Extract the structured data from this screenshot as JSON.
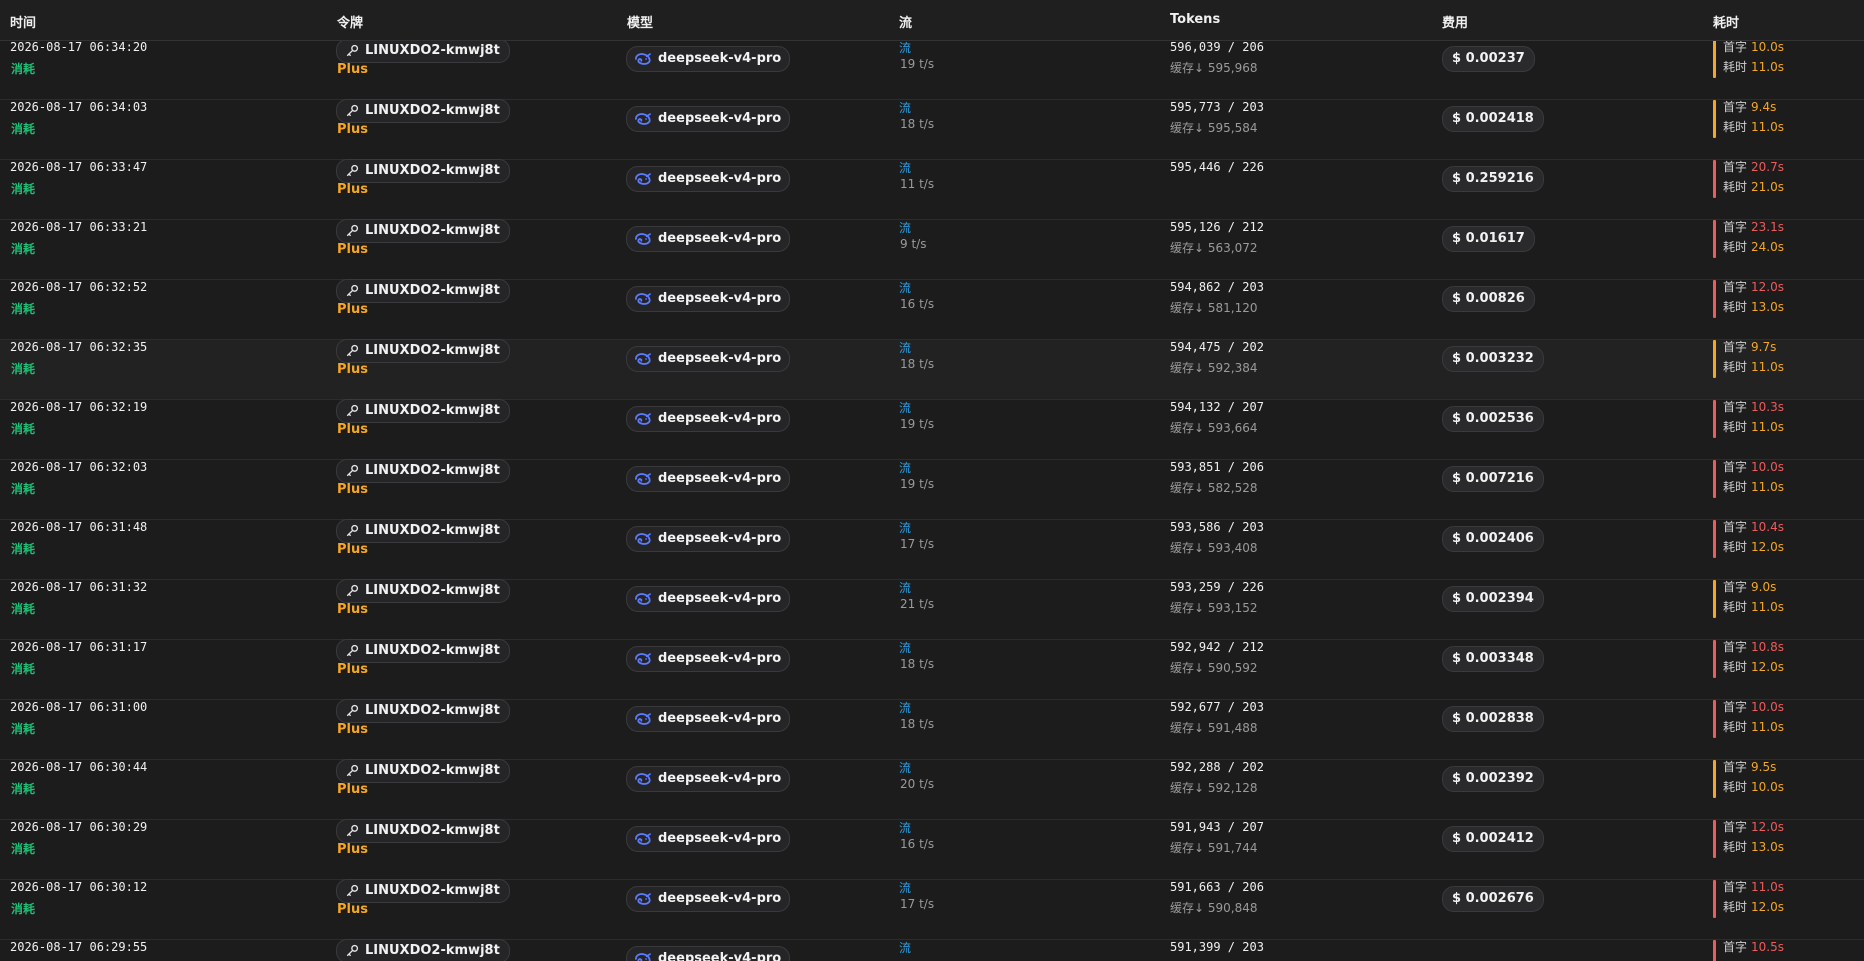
{
  "header": {
    "time": "时间",
    "token": "令牌",
    "model": "模型",
    "flow": "流",
    "tokens": "Tokens",
    "cost": "费用",
    "elapsed": "耗时"
  },
  "labels": {
    "type": "消耗",
    "group": "Plus",
    "flow": "流",
    "cache_prefix": "缓存↓",
    "first_token": "首字",
    "total_time": "耗时"
  },
  "colors": {
    "accent_orange": "#f5a623",
    "accent_red": "#ef5a5a",
    "type_green": "#1fbf74",
    "flow_blue": "#2a9fe0"
  },
  "rows": [
    {
      "time": "2026-08-17 06:34:20",
      "token": "LINUXDO2-kmwj8t",
      "model": "deepseek-v4-pro",
      "speed": "19 t/s",
      "tokens": "596,039 / 206",
      "cache": "595,968",
      "cost": "$ 0.00237",
      "first": "10.0s",
      "total": "11.0s",
      "first_color": "orange",
      "bar_color": "orange"
    },
    {
      "time": "2026-08-17 06:34:03",
      "token": "LINUXDO2-kmwj8t",
      "model": "deepseek-v4-pro",
      "speed": "18 t/s",
      "tokens": "595,773 / 203",
      "cache": "595,584",
      "cost": "$ 0.002418",
      "first": "9.4s",
      "total": "11.0s",
      "first_color": "orange",
      "bar_color": "orange"
    },
    {
      "time": "2026-08-17 06:33:47",
      "token": "LINUXDO2-kmwj8t",
      "model": "deepseek-v4-pro",
      "speed": "11 t/s",
      "tokens": "595,446 / 226",
      "cache": "",
      "cost": "$ 0.259216",
      "first": "20.7s",
      "total": "21.0s",
      "first_color": "red",
      "bar_color": "red"
    },
    {
      "time": "2026-08-17 06:33:21",
      "token": "LINUXDO2-kmwj8t",
      "model": "deepseek-v4-pro",
      "speed": "9 t/s",
      "tokens": "595,126 / 212",
      "cache": "563,072",
      "cost": "$ 0.01617",
      "first": "23.1s",
      "total": "24.0s",
      "first_color": "red",
      "bar_color": "red"
    },
    {
      "time": "2026-08-17 06:32:52",
      "token": "LINUXDO2-kmwj8t",
      "model": "deepseek-v4-pro",
      "speed": "16 t/s",
      "tokens": "594,862 / 203",
      "cache": "581,120",
      "cost": "$ 0.00826",
      "first": "12.0s",
      "total": "13.0s",
      "first_color": "red",
      "bar_color": "red"
    },
    {
      "time": "2026-08-17 06:32:35",
      "token": "LINUXDO2-kmwj8t",
      "model": "deepseek-v4-pro",
      "speed": "18 t/s",
      "tokens": "594,475 / 202",
      "cache": "592,384",
      "cost": "$ 0.003232",
      "first": "9.7s",
      "total": "11.0s",
      "first_color": "orange",
      "bar_color": "orange"
    },
    {
      "time": "2026-08-17 06:32:19",
      "token": "LINUXDO2-kmwj8t",
      "model": "deepseek-v4-pro",
      "speed": "19 t/s",
      "tokens": "594,132 / 207",
      "cache": "593,664",
      "cost": "$ 0.002536",
      "first": "10.3s",
      "total": "11.0s",
      "first_color": "red",
      "bar_color": "red"
    },
    {
      "time": "2026-08-17 06:32:03",
      "token": "LINUXDO2-kmwj8t",
      "model": "deepseek-v4-pro",
      "speed": "19 t/s",
      "tokens": "593,851 / 206",
      "cache": "582,528",
      "cost": "$ 0.007216",
      "first": "10.0s",
      "total": "11.0s",
      "first_color": "red",
      "bar_color": "red"
    },
    {
      "time": "2026-08-17 06:31:48",
      "token": "LINUXDO2-kmwj8t",
      "model": "deepseek-v4-pro",
      "speed": "17 t/s",
      "tokens": "593,586 / 203",
      "cache": "593,408",
      "cost": "$ 0.002406",
      "first": "10.4s",
      "total": "12.0s",
      "first_color": "red",
      "bar_color": "red"
    },
    {
      "time": "2026-08-17 06:31:32",
      "token": "LINUXDO2-kmwj8t",
      "model": "deepseek-v4-pro",
      "speed": "21 t/s",
      "tokens": "593,259 / 226",
      "cache": "593,152",
      "cost": "$ 0.002394",
      "first": "9.0s",
      "total": "11.0s",
      "first_color": "orange",
      "bar_color": "orange"
    },
    {
      "time": "2026-08-17 06:31:17",
      "token": "LINUXDO2-kmwj8t",
      "model": "deepseek-v4-pro",
      "speed": "18 t/s",
      "tokens": "592,942 / 212",
      "cache": "590,592",
      "cost": "$ 0.003348",
      "first": "10.8s",
      "total": "12.0s",
      "first_color": "red",
      "bar_color": "red"
    },
    {
      "time": "2026-08-17 06:31:00",
      "token": "LINUXDO2-kmwj8t",
      "model": "deepseek-v4-pro",
      "speed": "18 t/s",
      "tokens": "592,677 / 203",
      "cache": "591,488",
      "cost": "$ 0.002838",
      "first": "10.0s",
      "total": "11.0s",
      "first_color": "red",
      "bar_color": "red"
    },
    {
      "time": "2026-08-17 06:30:44",
      "token": "LINUXDO2-kmwj8t",
      "model": "deepseek-v4-pro",
      "speed": "20 t/s",
      "tokens": "592,288 / 202",
      "cache": "592,128",
      "cost": "$ 0.002392",
      "first": "9.5s",
      "total": "10.0s",
      "first_color": "orange",
      "bar_color": "orange"
    },
    {
      "time": "2026-08-17 06:30:29",
      "token": "LINUXDO2-kmwj8t",
      "model": "deepseek-v4-pro",
      "speed": "16 t/s",
      "tokens": "591,943 / 207",
      "cache": "591,744",
      "cost": "$ 0.002412",
      "first": "12.0s",
      "total": "13.0s",
      "first_color": "red",
      "bar_color": "red"
    },
    {
      "time": "2026-08-17 06:30:12",
      "token": "LINUXDO2-kmwj8t",
      "model": "deepseek-v4-pro",
      "speed": "17 t/s",
      "tokens": "591,663 / 206",
      "cache": "590,848",
      "cost": "$ 0.002676",
      "first": "11.0s",
      "total": "12.0s",
      "first_color": "red",
      "bar_color": "red"
    },
    {
      "time": "2026-08-17 06:29:55",
      "token": "LINUXDO2-kmwj8t",
      "model": "deepseek-v4-pro",
      "speed": "",
      "tokens": "591,399 / 203",
      "cache": "",
      "cost": "",
      "first": "10.5s",
      "total": "",
      "first_color": "red",
      "bar_color": "red"
    }
  ]
}
